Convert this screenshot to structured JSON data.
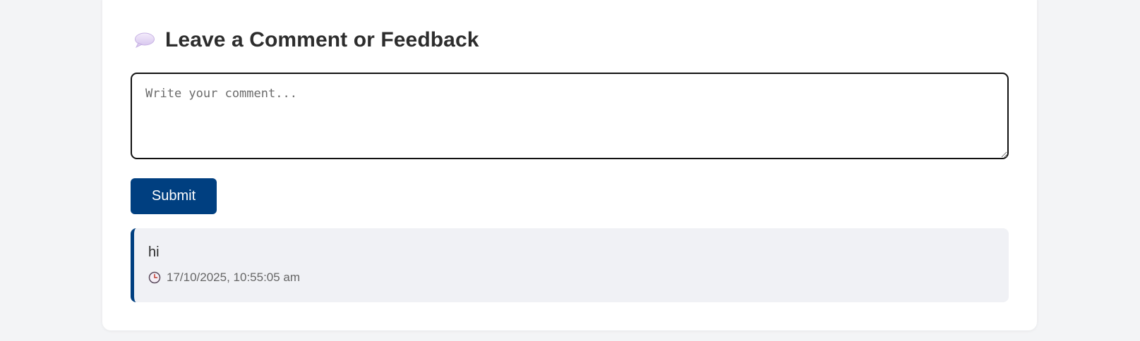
{
  "feedback": {
    "title": "Leave a Comment or Feedback",
    "title_icon": "speech-bubble-icon",
    "input": {
      "placeholder": "Write your comment...",
      "value": ""
    },
    "submit_label": "Submit"
  },
  "comments": [
    {
      "text": "hi",
      "timestamp": "17/10/2025, 10:55:05 am",
      "icon": "clock-icon"
    }
  ],
  "colors": {
    "accent": "#003f80",
    "card_background": "#ffffff",
    "page_background": "#f3f4f6",
    "comment_background": "#f0f1f5"
  }
}
